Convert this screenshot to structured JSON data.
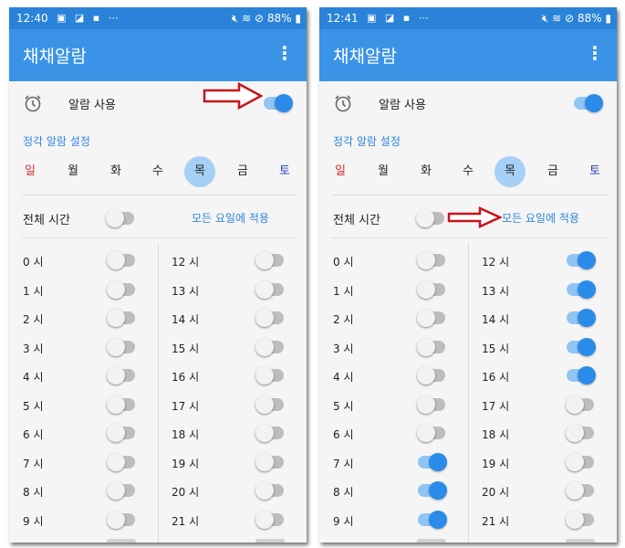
{
  "screens": [
    {
      "status": {
        "time": "12:40",
        "battery": "88%"
      },
      "app_title": "채채알람",
      "alarm_label": "알람 사용",
      "alarm_on": true,
      "section_title": "정각 알람 설정",
      "days": [
        "일",
        "월",
        "화",
        "수",
        "목",
        "금",
        "토"
      ],
      "selected_day": "목",
      "all_time_label": "전체 시간",
      "all_time_on": false,
      "apply_all_label": "모든 요일에 적용",
      "hours_left": [
        {
          "label": "0 시",
          "on": false
        },
        {
          "label": "1 시",
          "on": false
        },
        {
          "label": "2 시",
          "on": false
        },
        {
          "label": "3 시",
          "on": false
        },
        {
          "label": "4 시",
          "on": false
        },
        {
          "label": "5 시",
          "on": false
        },
        {
          "label": "6 시",
          "on": false
        },
        {
          "label": "7 시",
          "on": false
        },
        {
          "label": "8 시",
          "on": false
        },
        {
          "label": "9 시",
          "on": false
        }
      ],
      "hours_right": [
        {
          "label": "12 시",
          "on": false
        },
        {
          "label": "13 시",
          "on": false
        },
        {
          "label": "14 시",
          "on": false
        },
        {
          "label": "15 시",
          "on": false
        },
        {
          "label": "16 시",
          "on": false
        },
        {
          "label": "17 시",
          "on": false
        },
        {
          "label": "18 시",
          "on": false
        },
        {
          "label": "19 시",
          "on": false
        },
        {
          "label": "20 시",
          "on": false
        },
        {
          "label": "21 시",
          "on": false
        }
      ]
    },
    {
      "status": {
        "time": "12:41",
        "battery": "88%"
      },
      "app_title": "채채알람",
      "alarm_label": "알람 사용",
      "alarm_on": true,
      "section_title": "정각 알람 설정",
      "days": [
        "일",
        "월",
        "화",
        "수",
        "목",
        "금",
        "토"
      ],
      "selected_day": "목",
      "all_time_label": "전체 시간",
      "all_time_on": false,
      "apply_all_label": "모든 요일에 적용",
      "hours_left": [
        {
          "label": "0 시",
          "on": false
        },
        {
          "label": "1 시",
          "on": false
        },
        {
          "label": "2 시",
          "on": false
        },
        {
          "label": "3 시",
          "on": false
        },
        {
          "label": "4 시",
          "on": false
        },
        {
          "label": "5 시",
          "on": false
        },
        {
          "label": "6 시",
          "on": false
        },
        {
          "label": "7 시",
          "on": true
        },
        {
          "label": "8 시",
          "on": true
        },
        {
          "label": "9 시",
          "on": true
        }
      ],
      "hours_right": [
        {
          "label": "12 시",
          "on": true
        },
        {
          "label": "13 시",
          "on": true
        },
        {
          "label": "14 시",
          "on": true
        },
        {
          "label": "15 시",
          "on": true
        },
        {
          "label": "16 시",
          "on": true
        },
        {
          "label": "17 시",
          "on": false
        },
        {
          "label": "18 시",
          "on": false
        },
        {
          "label": "19 시",
          "on": false
        },
        {
          "label": "20 시",
          "on": false
        },
        {
          "label": "21 시",
          "on": false
        }
      ]
    }
  ],
  "colors": {
    "primary": "#3a93e6",
    "statusbar": "#2a83d8",
    "toggle_on": "#2b8be8",
    "link": "#2e86de",
    "sunday": "#d32f2f",
    "saturday": "#1e3fc4",
    "selected_day_bg": "#a6d0f5",
    "annotation_arrow": "#c8141e"
  },
  "icons": {
    "alarm": "alarm-clock-icon",
    "menu": "more-vert-icon",
    "annotation": "red-outline-arrow"
  }
}
